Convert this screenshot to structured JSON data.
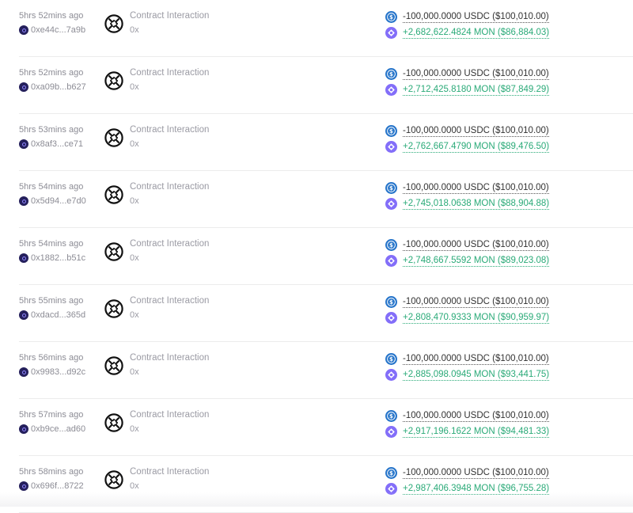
{
  "colors": {
    "positive": "#2aaa78",
    "negative": "#333333",
    "muted": "#8c8c95",
    "usdc": "#2775ca",
    "mon": "#836ef9"
  },
  "icons": {
    "address": "address-avatar-icon",
    "contract": "contract-interaction-icon",
    "usdc": "usdc-token-icon",
    "mon": "mon-token-icon"
  },
  "transactions": [
    {
      "time": "5hrs 52mins ago",
      "address": "0xe44c...7a9b",
      "method": "Contract Interaction",
      "value": "0x",
      "sent": "-100,000.0000 USDC ($100,010.00)",
      "received": "+2,682,622.4824 MON ($86,884.03)"
    },
    {
      "time": "5hrs 52mins ago",
      "address": "0xa09b...b627",
      "method": "Contract Interaction",
      "value": "0x",
      "sent": "-100,000.0000 USDC ($100,010.00)",
      "received": "+2,712,425.8180 MON ($87,849.29)"
    },
    {
      "time": "5hrs 53mins ago",
      "address": "0x8af3...ce71",
      "method": "Contract Interaction",
      "value": "0x",
      "sent": "-100,000.0000 USDC ($100,010.00)",
      "received": "+2,762,667.4790 MON ($89,476.50)"
    },
    {
      "time": "5hrs 54mins ago",
      "address": "0x5d94...e7d0",
      "method": "Contract Interaction",
      "value": "0x",
      "sent": "-100,000.0000 USDC ($100,010.00)",
      "received": "+2,745,018.0638 MON ($88,904.88)"
    },
    {
      "time": "5hrs 54mins ago",
      "address": "0x1882...b51c",
      "method": "Contract Interaction",
      "value": "0x",
      "sent": "-100,000.0000 USDC ($100,010.00)",
      "received": "+2,748,667.5592 MON ($89,023.08)"
    },
    {
      "time": "5hrs 55mins ago",
      "address": "0xdacd...365d",
      "method": "Contract Interaction",
      "value": "0x",
      "sent": "-100,000.0000 USDC ($100,010.00)",
      "received": "+2,808,470.9333 MON ($90,959.97)"
    },
    {
      "time": "5hrs 56mins ago",
      "address": "0x9983...d92c",
      "method": "Contract Interaction",
      "value": "0x",
      "sent": "-100,000.0000 USDC ($100,010.00)",
      "received": "+2,885,098.0945 MON ($93,441.75)"
    },
    {
      "time": "5hrs 57mins ago",
      "address": "0xb9ce...ad60",
      "method": "Contract Interaction",
      "value": "0x",
      "sent": "-100,000.0000 USDC ($100,010.00)",
      "received": "+2,917,196.1622 MON ($94,481.33)"
    },
    {
      "time": "5hrs 58mins ago",
      "address": "0x696f...8722",
      "method": "Contract Interaction",
      "value": "0x",
      "sent": "-100,000.0000 USDC ($100,010.00)",
      "received": "+2,987,406.3948 MON ($96,755.28)"
    }
  ]
}
